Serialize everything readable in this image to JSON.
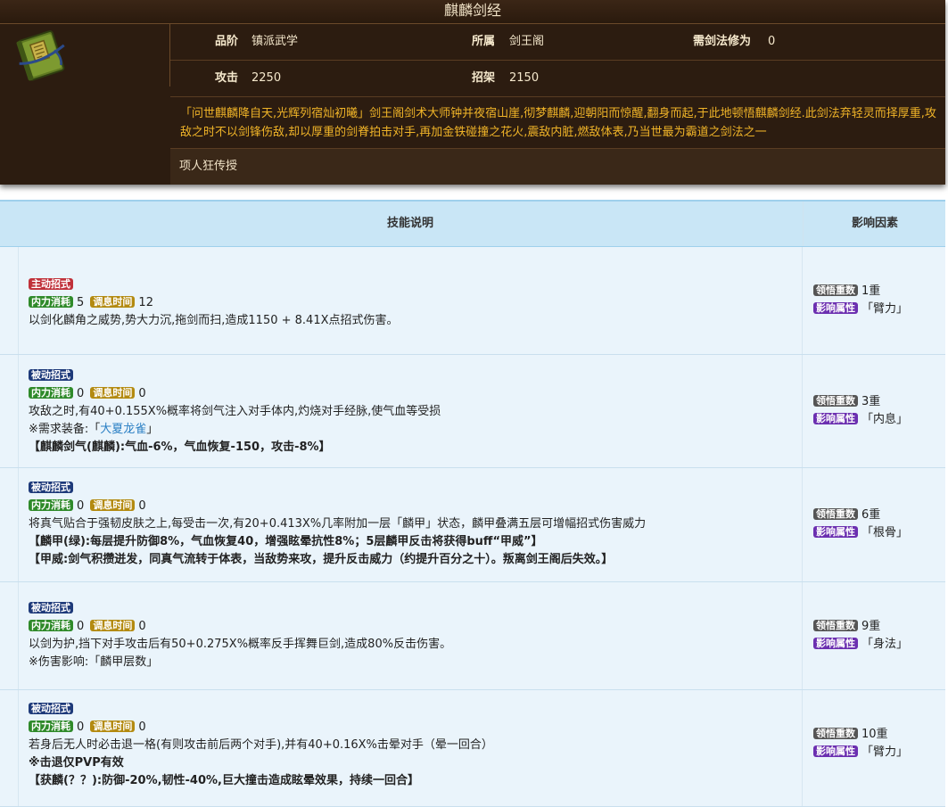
{
  "book": {
    "title": "麒麟剑经",
    "grade_label": "品阶",
    "grade_value": "镇派武学",
    "belong_label": "所属",
    "belong_value": "剑王阁",
    "req_label": "需剑法修为",
    "req_value": "0",
    "attack_label": "攻击",
    "attack_value": "2250",
    "parry_label": "招架",
    "parry_value": "2150",
    "description": "「问世麒麟降自天,光辉列宿灿初曦」剑王阁剑术大师钟并夜宿山崖,彻梦麒麟,迎朝阳而惊醒,翻身而起,于此地顿悟麒麟剑经.此剑法弃轻灵而择厚重,攻敌之时不以剑锋伤敌,却以厚重的剑脊拍击对手,再加金铁碰撞之花火,震敌内脏,燃敌体表,乃当世最为霸道之剑法之一",
    "source": "项人狂传授"
  },
  "table": {
    "header_main": "技能说明",
    "header_side": "影响因素"
  },
  "labels": {
    "neili": "内力消耗",
    "tiaoxi": "调息时间",
    "lingwu": "领悟重数",
    "attr": "影响属性"
  },
  "skills": [
    {
      "type": "主动招式",
      "neili": "5",
      "tiaoxi": "12",
      "lines": [
        "以剑化麟角之威势,势大力沉,拖剑而扫,造成1150 + 8.41X点招式伤害。"
      ],
      "level": "1重",
      "attr": "「臂力」"
    },
    {
      "type": "被动招式",
      "neili": "0",
      "tiaoxi": "0",
      "lines": [
        "攻敌之时,有40+0.155X%概率将剑气注入对手体内,灼烧对手经脉,使气血等受损"
      ],
      "equip_prefix": "※需求装备:「",
      "equip_link": "大夏龙雀",
      "equip_suffix": "」",
      "bold_lines": [
        "【麒麟剑气(麒麟):气血-6%，气血恢复-150，攻击-8%】"
      ],
      "level": "3重",
      "attr": "「内息」"
    },
    {
      "type": "被动招式",
      "neili": "0",
      "tiaoxi": "0",
      "lines": [
        "将真气贴合于强韧皮肤之上,每受击一次,有20+0.413X%几率附加一层「麟甲」状态，麟甲叠满五层可增幅招式伤害威力"
      ],
      "bold_lines": [
        "【麟甲(绿):每层提升防御8%，气血恢复40，增强眩晕抗性8%；5层麟甲反击将获得buff“甲威”】",
        "【甲威:剑气积攒迸发，同真气流转于体表，当敌势来攻，提升反击威力（约提升百分之十）。叛离剑王阁后失效。】"
      ],
      "level": "6重",
      "attr": "「根骨」"
    },
    {
      "type": "被动招式",
      "neili": "0",
      "tiaoxi": "0",
      "lines": [
        "以剑为护,挡下对手攻击后有50+0.275X%概率反手挥舞巨剑,造成80%反击伤害。",
        "※伤害影响:「麟甲层数」"
      ],
      "level": "9重",
      "attr": "「身法」"
    },
    {
      "type": "被动招式",
      "neili": "0",
      "tiaoxi": "0",
      "lines": [
        "若身后无人时必击退一格(有则攻击前后两个对手),并有40+0.16X%击晕对手（晕一回合）"
      ],
      "bold_lines": [
        "※击退仅PVP有效",
        "【获麟(？？):防御-20%,韧性-40%,巨大撞击造成眩晕效果，持续一回合】"
      ],
      "level": "10重",
      "attr": "「臂力」"
    }
  ],
  "colors": {
    "card_bg": "#2c1c10",
    "desc_text": "#f0b428",
    "header_bg": "#c9e6f6",
    "row_bg": "#eaf4fb",
    "tag_active": "#c0313a",
    "tag_passive": "#1e3a7a",
    "tag_neili": "#2f8a2a",
    "tag_tiaoxi": "#b38a10",
    "tag_attr": "#6b2fb0"
  },
  "icons": [
    "book-icon"
  ]
}
